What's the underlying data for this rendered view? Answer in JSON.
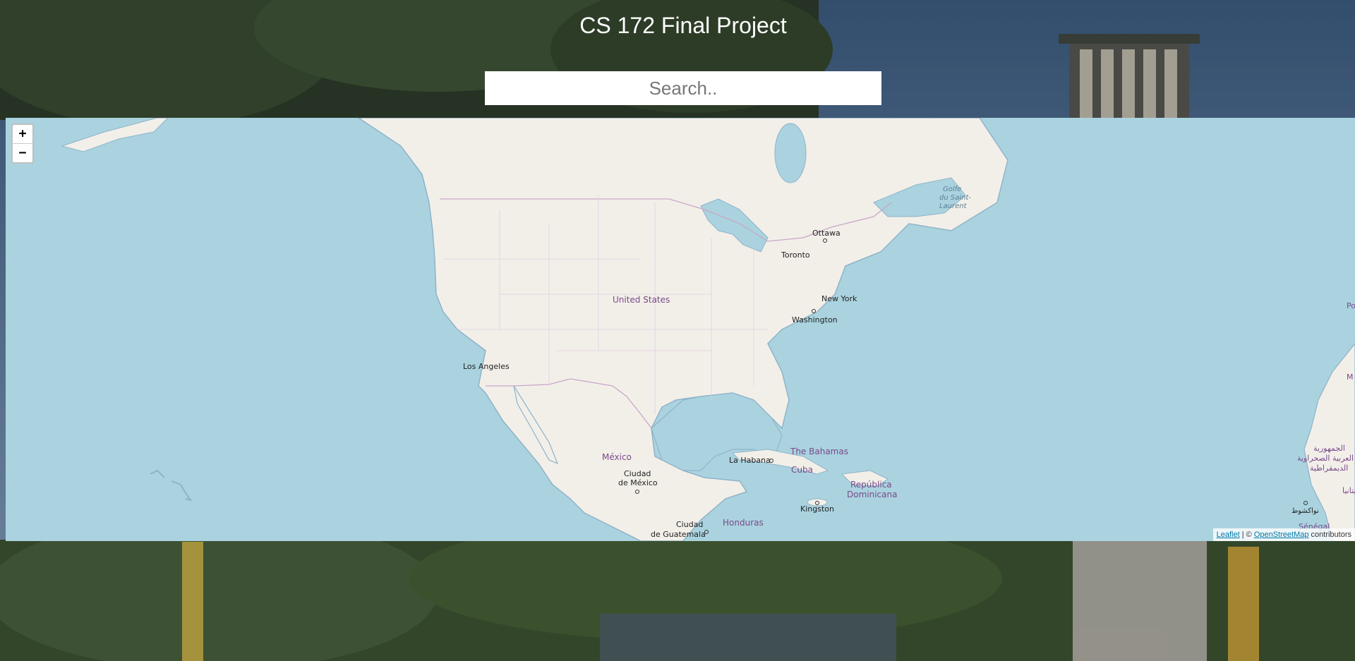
{
  "header": {
    "title": "CS 172 Final Project"
  },
  "search": {
    "placeholder": "Search.."
  },
  "map": {
    "zoom_in_label": "+",
    "zoom_out_label": "−",
    "labels": {
      "ottawa": "Ottawa",
      "toronto": "Toronto",
      "united_states": "United States",
      "new_york": "New York",
      "washington": "Washington",
      "los_angeles": "Los Angeles",
      "mexico": "México",
      "ciudad_de_mexico_1": "Ciudad",
      "ciudad_de_mexico_2": "de México",
      "la_habana": "La Habana",
      "the_bahamas": "The Bahamas",
      "cuba": "Cuba",
      "republica_1": "República",
      "republica_2": "Dominicana",
      "kingston": "Kingston",
      "guatemala_1": "Ciudad",
      "guatemala_2": "de Guatemala",
      "honduras": "Honduras",
      "golfe_1": "Golfe",
      "golfe_2": "du Saint-",
      "golfe_3": "Laurent",
      "sahrawi_1": "الجمهورية",
      "sahrawi_2": "العربية الصحراوية",
      "sahrawi_3": "الديمقراطية",
      "mauritania": "موريتانيا",
      "nouakchott": "نواكشوط",
      "senegal": "Sénégal",
      "po": "Po",
      "m": "M"
    },
    "attribution": {
      "leaflet": "Leaflet",
      "separator": " | © ",
      "osm": "OpenStreetMap",
      "contributors": " contributors"
    }
  },
  "colors": {
    "water": "#aad3df",
    "land": "#f2efe9",
    "border": "#c9a6c9",
    "coast": "#8fb3c9",
    "place_label": "#7a4a8a"
  }
}
